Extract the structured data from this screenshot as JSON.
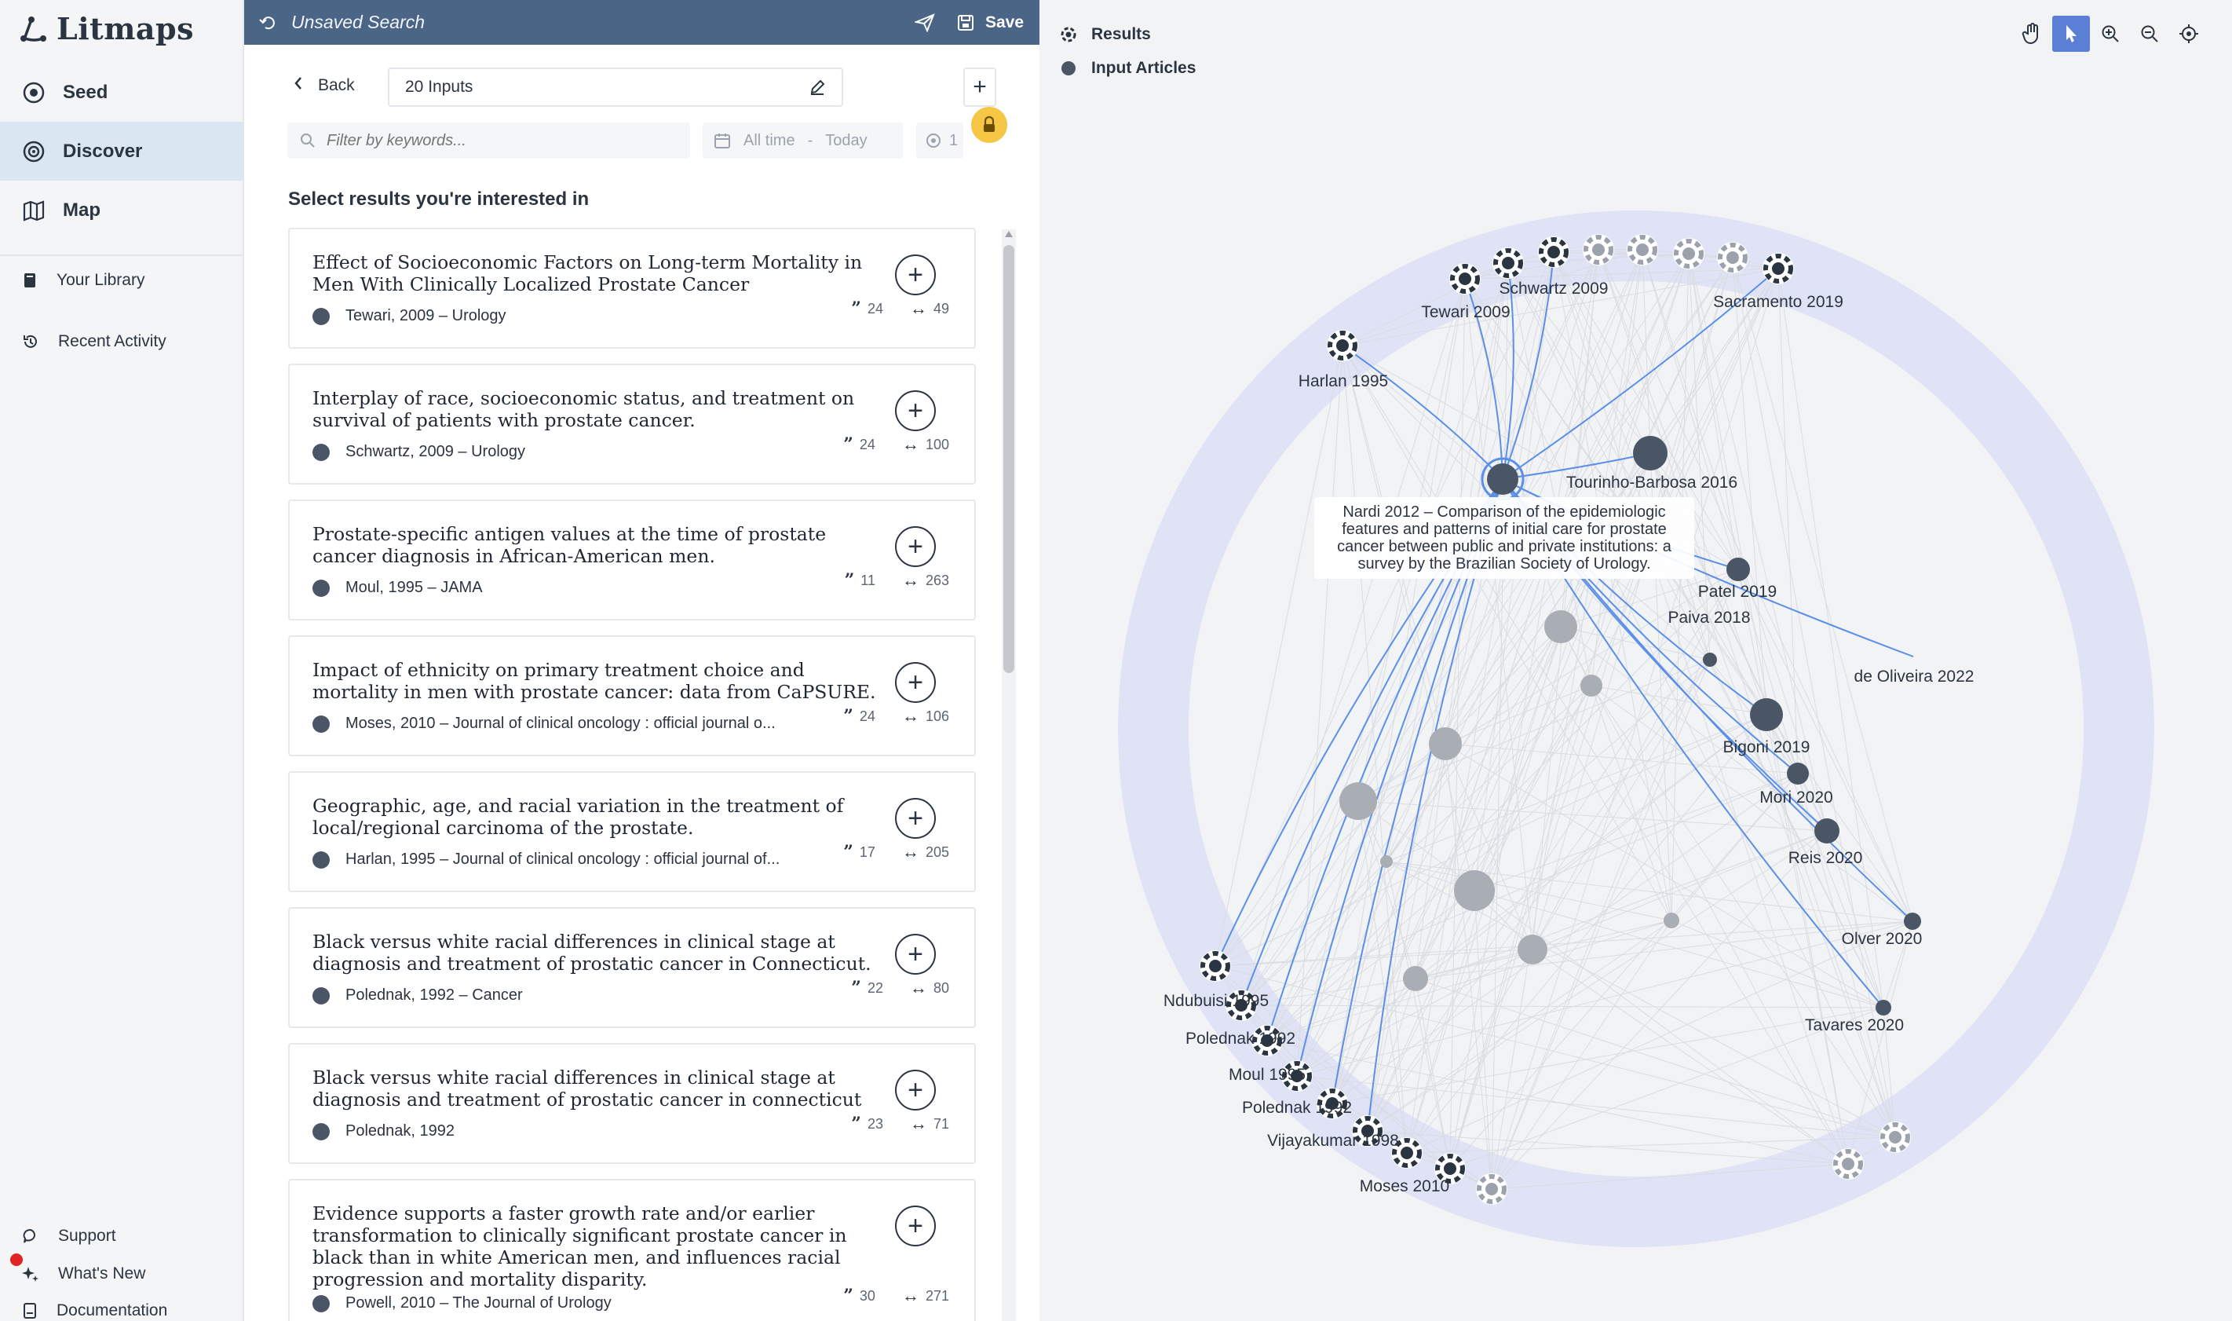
{
  "app": {
    "brand": "Litmaps",
    "accent": "#5c7fd6",
    "topbar_color": "#4b6587"
  },
  "sidebar": {
    "main_items": [
      {
        "label": "Seed",
        "icon": "seed-icon"
      },
      {
        "label": "Discover",
        "icon": "discover-icon",
        "active": true
      },
      {
        "label": "Map",
        "icon": "map-icon"
      }
    ],
    "library_items": [
      {
        "label": "Your Library",
        "icon": "library-icon"
      },
      {
        "label": "Recent Activity",
        "icon": "history-icon"
      }
    ],
    "footer_items": [
      {
        "label": "Support",
        "icon": "chat-icon"
      },
      {
        "label": "What's New",
        "icon": "sparkle-icon"
      },
      {
        "label": "Documentation",
        "icon": "docs-icon"
      }
    ]
  },
  "search": {
    "title": "Unsaved Search",
    "save_label": "Save",
    "back_label": "Back",
    "inputs_label": "20 Inputs",
    "filter_placeholder": "Filter by keywords...",
    "date_from": "All time",
    "date_sep": "-",
    "date_to": "Today",
    "extra_filter": "1",
    "section_title": "Select results you're interested in"
  },
  "results": [
    {
      "title": "Effect of Socioeconomic Factors on Long-term Mortality in Men With Clinically Localized Prostate Cancer",
      "meta": "Tewari, 2009 – Urology",
      "cites": "24",
      "refs": "49"
    },
    {
      "title": "Interplay of race, socioeconomic status, and treatment on survival of patients with prostate cancer.",
      "meta": "Schwartz, 2009 – Urology",
      "cites": "24",
      "refs": "100"
    },
    {
      "title": "Prostate-specific antigen values at the time of prostate cancer diagnosis in African-American men.",
      "meta": "Moul, 1995 – JAMA",
      "cites": "11",
      "refs": "263"
    },
    {
      "title": "Impact of ethnicity on primary treatment choice and mortality in men with prostate cancer: data from CaPSURE.",
      "meta": "Moses, 2010 – Journal of clinical oncology : official journal o...",
      "cites": "24",
      "refs": "106"
    },
    {
      "title": "Geographic, age, and racial variation in the treatment of local/regional carcinoma of the prostate.",
      "meta": "Harlan, 1995 – Journal of clinical oncology : official journal of...",
      "cites": "17",
      "refs": "205"
    },
    {
      "title": "Black versus white racial differences in clinical stage at diagnosis and treatment of prostatic cancer in Connecticut.",
      "meta": "Polednak, 1992 – Cancer",
      "cites": "22",
      "refs": "80"
    },
    {
      "title": "Black versus white racial differences in clinical stage at diagnosis and treatment of prostatic cancer in connecticut",
      "meta": "Polednak, 1992",
      "cites": "23",
      "refs": "71"
    },
    {
      "title": "Evidence supports a faster growth rate and/or earlier transformation to clinically significant prostate cancer in black than in white American men, and influences racial progression and mortality disparity.",
      "meta": "Powell, 2010 – The Journal of Urology",
      "cites": "30",
      "refs": "271"
    }
  ],
  "map": {
    "legend": [
      {
        "label": "Results",
        "icon": "results-icon"
      },
      {
        "label": "Input Articles",
        "icon": "input-dot-icon"
      }
    ],
    "tools": [
      "hand-icon",
      "cursor-icon",
      "zoom-in-icon",
      "zoom-out-icon",
      "locate-icon"
    ],
    "tooltip": "Nardi 2012 – Comparison of the epidemiologic features and patterns of initial care for prostate cancer between public and private institutions: a survey by the Brazilian Society of Urology.",
    "labels": [
      "Schwartz 2009",
      "Tewari 2009",
      "Sacramento 2019",
      "Harlan 1995",
      "Tourinho-Barbosa 2016",
      "Patel 2019",
      "Paiva 2018",
      "de Oliveira 2022",
      "Bigoni 2019",
      "Mori 2020",
      "Reis 2020",
      "Olver 2020",
      "Tavares 2020",
      "Ndubuisi 1995",
      "Polednak 1992",
      "Moul 1995",
      "Polednak 1992",
      "Vijayakumar 1998",
      "Moses 2010"
    ]
  }
}
